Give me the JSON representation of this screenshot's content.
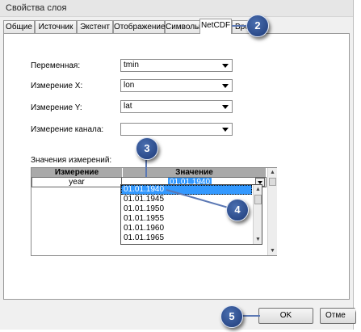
{
  "window": {
    "title": "Свойства слоя"
  },
  "tabs": [
    {
      "label": "Общие",
      "active": false
    },
    {
      "label": "Источник",
      "active": false
    },
    {
      "label": "Экстент",
      "active": false
    },
    {
      "label": "Отображение",
      "active": false
    },
    {
      "label": "Символы",
      "active": false
    },
    {
      "label": "NetCDF",
      "active": true
    },
    {
      "label": "Врем",
      "active": false
    }
  ],
  "form": {
    "variable": {
      "label": "Переменная:",
      "value": "tmin"
    },
    "dim_x": {
      "label": "Измерение X:",
      "value": "lon"
    },
    "dim_y": {
      "label": "Измерение Y:",
      "value": "lat"
    },
    "band_dim": {
      "label": "Измерение канала:",
      "value": ""
    }
  },
  "dims": {
    "label": "Значения измерений:",
    "headers": {
      "dimension": "Измерение",
      "value": "Значение"
    },
    "row": {
      "dimension": "year",
      "value": "01.01.1940"
    }
  },
  "dropdown": {
    "options": [
      "01.01.1940",
      "01.01.1945",
      "01.01.1950",
      "01.01.1955",
      "01.01.1960",
      "01.01.1965"
    ],
    "selected_index": 0
  },
  "buttons": {
    "ok": "OK",
    "cancel": "Отме"
  },
  "callouts": [
    "2",
    "3",
    "4",
    "5"
  ],
  "colors": {
    "selection": "#3399ff",
    "badge": "#1e3a78",
    "header": "#a9a9a9"
  }
}
